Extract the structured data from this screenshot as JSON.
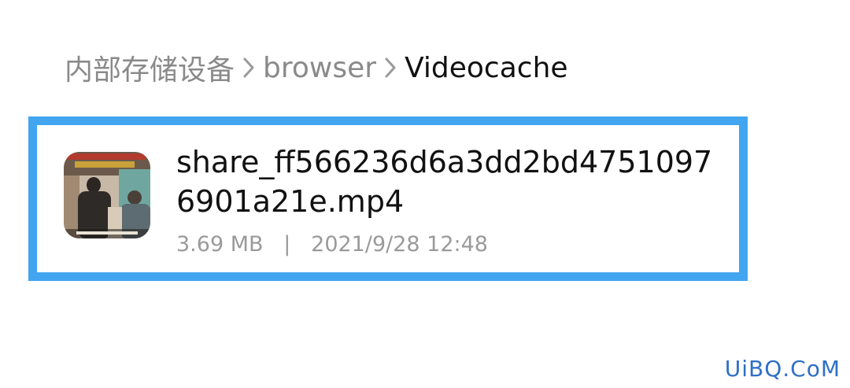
{
  "breadcrumb": {
    "items": [
      {
        "label": "内部存储设备"
      },
      {
        "label": "browser"
      },
      {
        "label": "Videocache"
      }
    ]
  },
  "file": {
    "name": "share_ff566236d6a3dd2bd47510976901a21e.mp4",
    "size": "3.69 MB",
    "separator": "|",
    "date": "2021/9/28 12:48",
    "highlight_color": "#42a5f0"
  },
  "watermark": {
    "text": "UiBQ.CoM"
  }
}
